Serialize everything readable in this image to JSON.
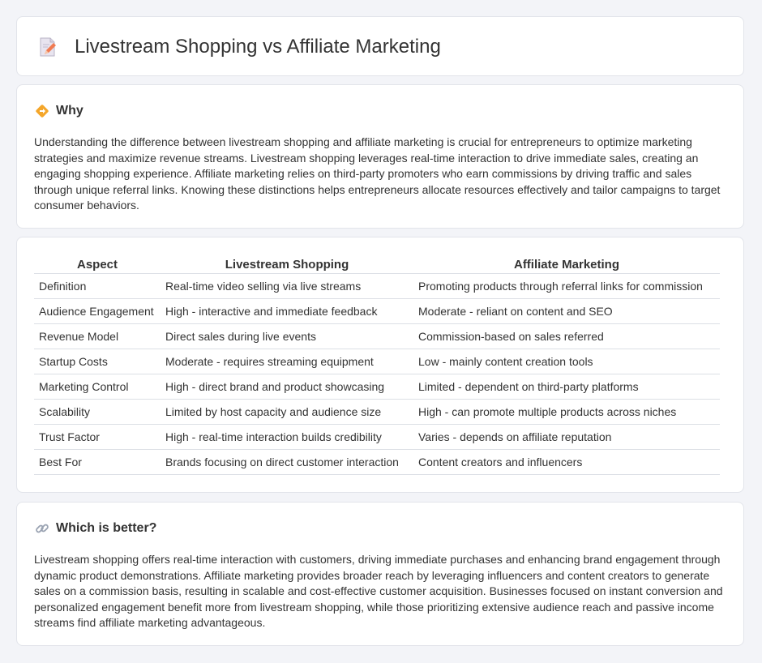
{
  "header": {
    "title": "Livestream Shopping vs Affiliate Marketing",
    "icon": "document-pencil-icon"
  },
  "why": {
    "title": "Why",
    "icon": "diamond-arrow-icon",
    "text": "Understanding the difference between livestream shopping and affiliate marketing is crucial for entrepreneurs to optimize marketing strategies and maximize revenue streams. Livestream shopping leverages real-time interaction to drive immediate sales, creating an engaging shopping experience. Affiliate marketing relies on third-party promoters who earn commissions by driving traffic and sales through unique referral links. Knowing these distinctions helps entrepreneurs allocate resources effectively and tailor campaigns to target consumer behaviors."
  },
  "table": {
    "headers": [
      "Aspect",
      "Livestream Shopping",
      "Affiliate Marketing"
    ],
    "rows": [
      [
        "Definition",
        "Real-time video selling via live streams",
        "Promoting products through referral links for commission"
      ],
      [
        "Audience Engagement",
        "High - interactive and immediate feedback",
        "Moderate - reliant on content and SEO"
      ],
      [
        "Revenue Model",
        "Direct sales during live events",
        "Commission-based on sales referred"
      ],
      [
        "Startup Costs",
        "Moderate - requires streaming equipment",
        "Low - mainly content creation tools"
      ],
      [
        "Marketing Control",
        "High - direct brand and product showcasing",
        "Limited - dependent on third-party platforms"
      ],
      [
        "Scalability",
        "Limited by host capacity and audience size",
        "High - can promote multiple products across niches"
      ],
      [
        "Trust Factor",
        "High - real-time interaction builds credibility",
        "Varies - depends on affiliate reputation"
      ],
      [
        "Best For",
        "Brands focusing on direct customer interaction",
        "Content creators and influencers"
      ]
    ]
  },
  "better": {
    "title": "Which is better?",
    "icon": "link-icon",
    "text": "Livestream shopping offers real-time interaction with customers, driving immediate purchases and enhancing brand engagement through dynamic product demonstrations. Affiliate marketing provides broader reach by leveraging influencers and content creators to generate sales on a commission basis, resulting in scalable and cost-effective customer acquisition. Businesses focused on instant conversion and personalized engagement benefit more from livestream shopping, while those prioritizing extensive audience reach and passive income streams find affiliate marketing advantageous."
  }
}
